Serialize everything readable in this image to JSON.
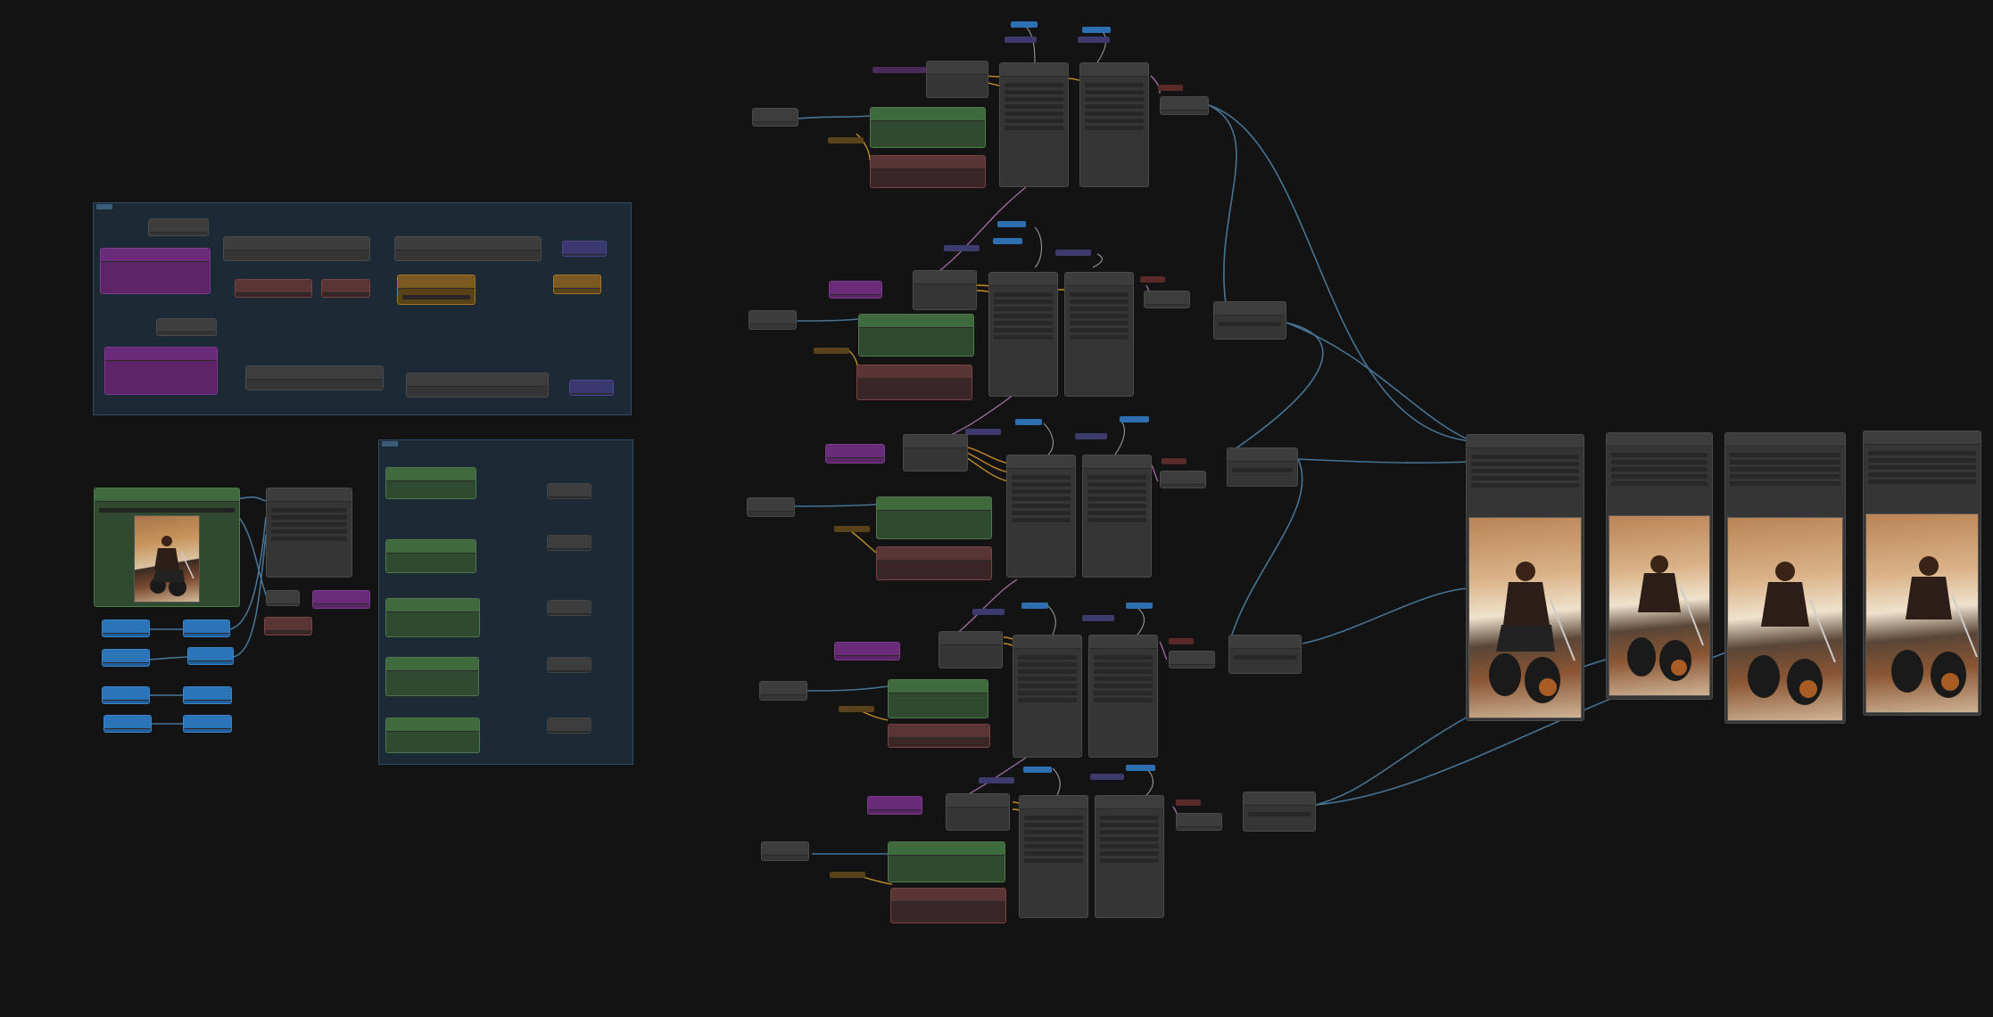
{
  "app": {
    "name": "node-graph-editor"
  },
  "colors": {
    "background": "#131313",
    "group": "#1c2a36",
    "link_blue": "#4d7fa3",
    "link_orange": "#d49a2c",
    "link_pink": "#c07fc4",
    "link_green": "#7fb07a"
  },
  "groups": [
    {
      "id": "group-top-left"
    },
    {
      "id": "group-bottom-right"
    }
  ],
  "sampler_columns": 5,
  "output_images": 4,
  "preview_image": {
    "subject": "motorcycle-rider-illustration"
  }
}
